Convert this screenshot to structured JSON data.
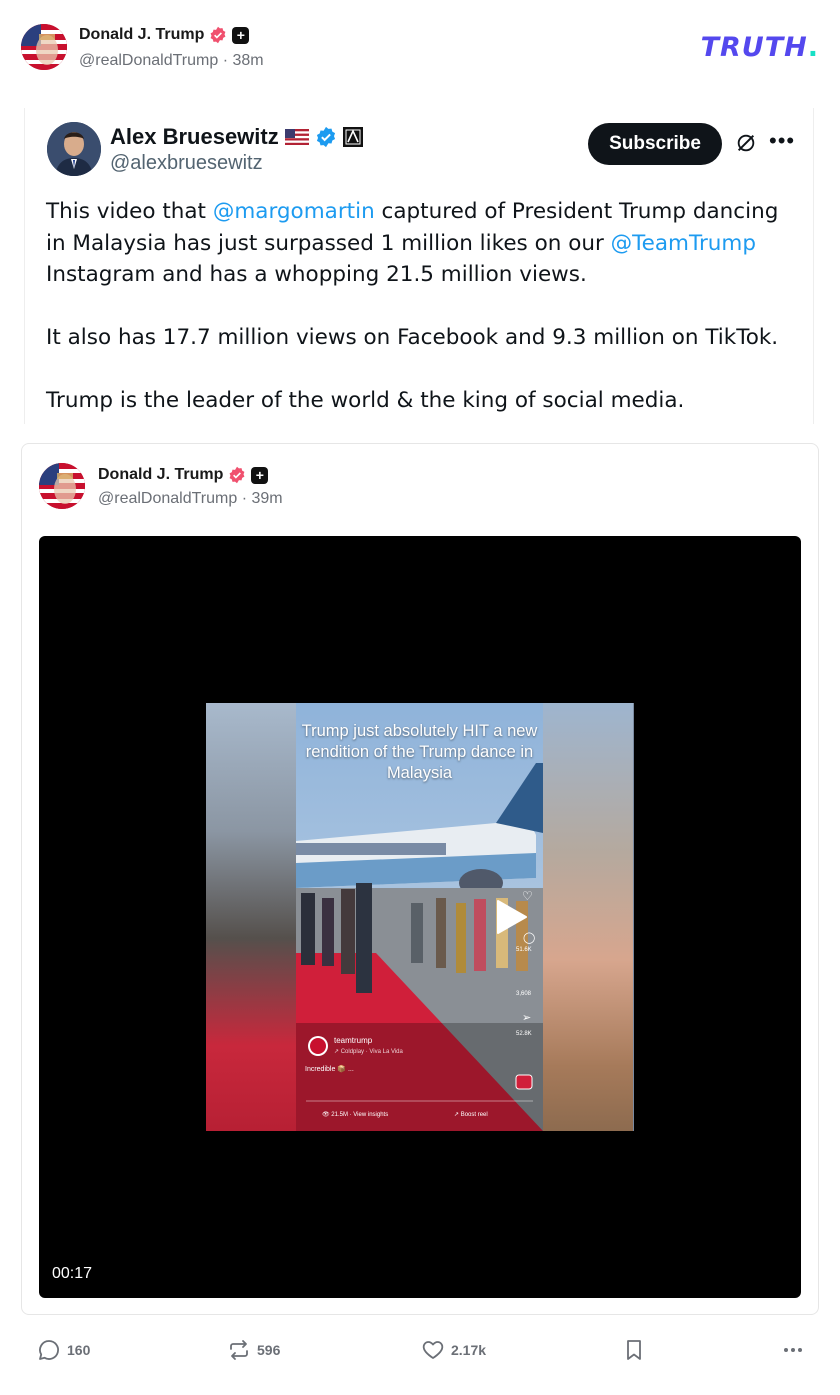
{
  "post": {
    "author_name": "Donald J. Trump",
    "handle": "@realDonaldTrump",
    "time": "38m",
    "separator": " · "
  },
  "brand": {
    "logo_text": "TRUTH",
    "logo_dot": ".",
    "accent": "#5448ee",
    "dot_color": "#17e0c5"
  },
  "embed": {
    "name": "Alex Bruesewitz",
    "handle": "@alexbruesewitz",
    "subscribe_label": "Subscribe",
    "more_icon": "more-horizontal-icon",
    "p1": {
      "t1": "This video that ",
      "m1": "@margomartin",
      "t2": " captured of President Trump dancing in Malaysia has just surpassed 1 million likes on our ",
      "m2": "@TeamTrump",
      "t3": " Instagram and has a whopping 21.5 million views."
    },
    "p2": "It also has 17.7 million views on Facebook and 9.3 million on TikTok.",
    "p3": "Trump is the leader of the world & the king of social media.",
    "mention_color": "#1d9bf0"
  },
  "quote": {
    "author_name": "Donald J. Trump",
    "handle": "@realDonaldTrump",
    "time": "39m",
    "separator": " · ",
    "video": {
      "duration": "00:17",
      "caption": "Trump just absolutely HIT a new rendition of the Trump dance in Malaysia",
      "ig_user": "teamtrump",
      "ig_song": "↗ Coldplay · Viva La Vida",
      "ig_caption": "Incredible 📦 ...",
      "ig_views": "👁 21.5M · View insights",
      "ig_boost": "↗ Boost reel",
      "ig_comments": "51.6K",
      "ig_reposts": "3,608",
      "ig_shares": "52.8K"
    }
  },
  "actions": {
    "replies": "160",
    "reposts": "596",
    "likes": "2.17k"
  }
}
